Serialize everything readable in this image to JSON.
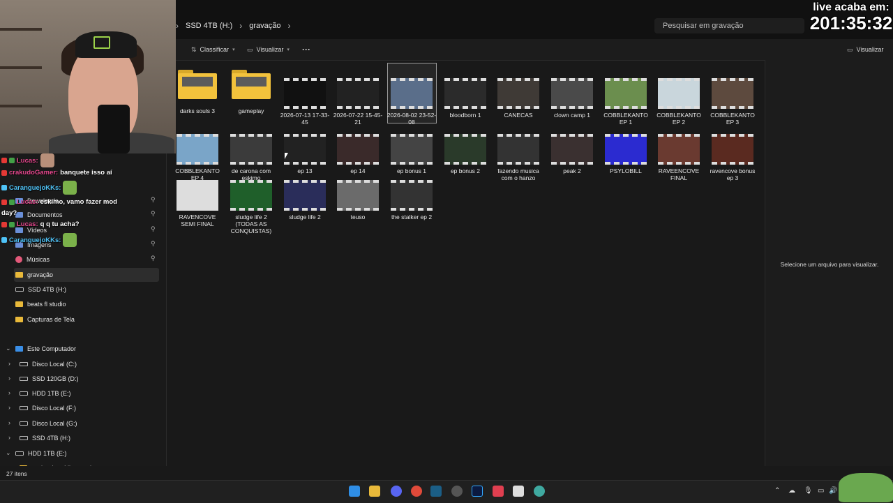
{
  "breadcrumb": {
    "overflow": "›",
    "drive": "SSD 4TB (H:)",
    "folder": "gravação",
    "trailing": "›"
  },
  "search": {
    "placeholder": "Pesquisar em gravação"
  },
  "toolbar": {
    "sort_label": "Classificar",
    "view_label": "Visualizar",
    "more_label": "···",
    "preview_label": "Visualizar"
  },
  "sidebar": {
    "items": [
      {
        "label": "Downloads",
        "icon": "download-icon"
      },
      {
        "label": "Documentos",
        "icon": "document-icon"
      },
      {
        "label": "Vídeos",
        "icon": "video-icon"
      },
      {
        "label": "Imagens",
        "icon": "image-icon"
      },
      {
        "label": "Músicas",
        "icon": "music-icon"
      },
      {
        "label": "gravação",
        "icon": "folder-icon"
      },
      {
        "label": "SSD 4TB (H:)",
        "icon": "drive-icon"
      },
      {
        "label": "beats fl studio",
        "icon": "folder-icon"
      },
      {
        "label": "Capturas de Tela",
        "icon": "folder-icon"
      },
      {
        "label": "Este Computador",
        "icon": "computer-icon"
      },
      {
        "label": "Disco Local (C:)",
        "icon": "drive-icon"
      },
      {
        "label": "SSD 120GB (D:)",
        "icon": "drive-icon"
      },
      {
        "label": "HDD 1TB (E:)",
        "icon": "drive-icon"
      },
      {
        "label": "Disco Local (F:)",
        "icon": "drive-icon"
      },
      {
        "label": "Disco Local (G:)",
        "icon": "drive-icon"
      },
      {
        "label": "SSD 4TB (H:)",
        "icon": "drive-icon"
      },
      {
        "label": "HDD 1TB (E:)",
        "icon": "drive-icon"
      },
      {
        "label": "cache de mídia premiere",
        "icon": "folder-icon"
      }
    ]
  },
  "files": [
    {
      "name": "darks souls 3",
      "kind": "folder"
    },
    {
      "name": "gameplay",
      "kind": "folder"
    },
    {
      "name": "2026-07-13 17-33-45",
      "kind": "video"
    },
    {
      "name": "2026-07-22 15-45-21",
      "kind": "video"
    },
    {
      "name": "2026-08-02 23-52-08",
      "kind": "video"
    },
    {
      "name": "bloodborn 1",
      "kind": "video"
    },
    {
      "name": "CANECAS",
      "kind": "video"
    },
    {
      "name": "clown camp 1",
      "kind": "video"
    },
    {
      "name": "COBBLEKANTO EP 1",
      "kind": "video"
    },
    {
      "name": "COBBLEKANTO EP 2",
      "kind": "video"
    },
    {
      "name": "COBBLEKANTO EP 3",
      "kind": "video"
    },
    {
      "name": "COBBLEKANTO EP 4",
      "kind": "video"
    },
    {
      "name": "de carona com eskimo",
      "kind": "video"
    },
    {
      "name": "ep 13",
      "kind": "video"
    },
    {
      "name": "ep 14",
      "kind": "video"
    },
    {
      "name": "ep bonus 1",
      "kind": "video"
    },
    {
      "name": "ep bonus 2",
      "kind": "video"
    },
    {
      "name": "fazendo musica com o hanzo",
      "kind": "video"
    },
    {
      "name": "peak 2",
      "kind": "video"
    },
    {
      "name": "PSYLOBILL",
      "kind": "video"
    },
    {
      "name": "RAVEENCOVE FINAL",
      "kind": "video"
    },
    {
      "name": "ravencove bonus ep 3",
      "kind": "video"
    },
    {
      "name": "RAVENCOVE SEMI FINAL",
      "kind": "video"
    },
    {
      "name": "sludge life 2 (TODAS AS CONQUISTAS)",
      "kind": "video"
    },
    {
      "name": "sludge life 2",
      "kind": "video"
    },
    {
      "name": "teuso",
      "kind": "video"
    },
    {
      "name": "the stalker ep 2",
      "kind": "video"
    }
  ],
  "preview": {
    "empty_text": "Selecione um arquivo para visualizar."
  },
  "status": {
    "count": "27 itens"
  },
  "overlay": {
    "live_title": "live acaba em:",
    "live_timer": "201:35:32"
  },
  "chat": [
    {
      "user": "Lucas:",
      "message": "",
      "color": "#e8488f"
    },
    {
      "user": "crakudoGamer:",
      "message": "banquete isso aí",
      "color": "#e8488f"
    },
    {
      "user": "CaranguejoKKs:",
      "message": "",
      "color": "#4fc3f7"
    },
    {
      "user": "Lucas:",
      "message": "eskimo, vamo fazer mod",
      "color": "#e8488f"
    },
    {
      "user": "",
      "message": "day?",
      "color": "#ffffff"
    },
    {
      "user": "Lucas:",
      "message": "q q tu acha?",
      "color": "#e8488f"
    },
    {
      "user": "CaranguejoKKs:",
      "message": "",
      "color": "#4fc3f7"
    }
  ]
}
